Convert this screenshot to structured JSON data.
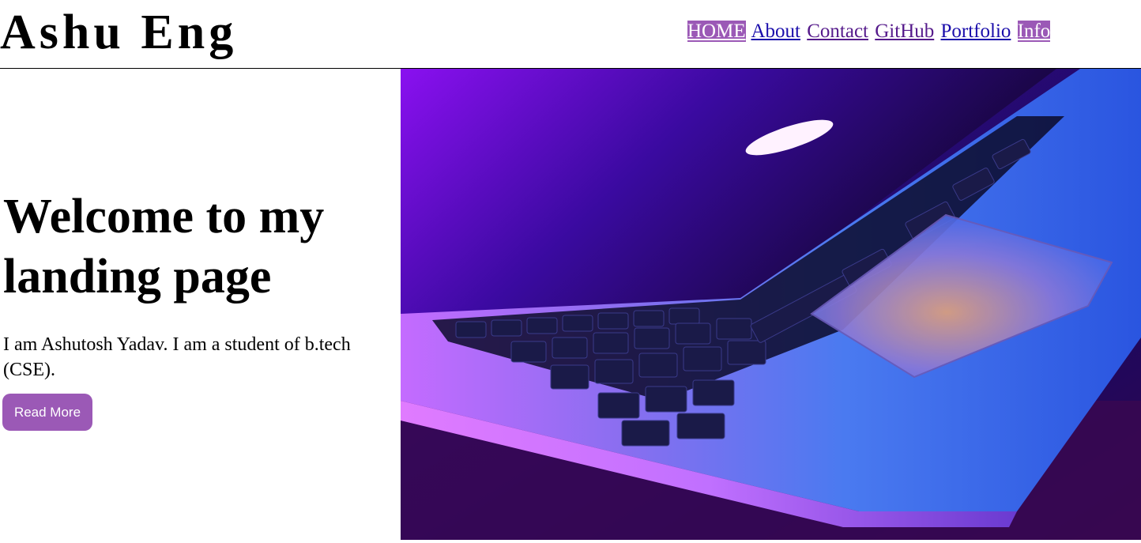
{
  "header": {
    "brand": "Ashu Eng",
    "nav": [
      {
        "label": "HOME",
        "state": "active"
      },
      {
        "label": "About",
        "state": "plain"
      },
      {
        "label": "Contact",
        "state": "visited"
      },
      {
        "label": "GitHub",
        "state": "visited"
      },
      {
        "label": "Portfolio",
        "state": "plain"
      },
      {
        "label": "Info",
        "state": "active"
      }
    ]
  },
  "hero": {
    "title": "Welcome to my landing page",
    "description": "I am Ashutosh Yadav. I am a student of b.tech (CSE).",
    "button_label": "Read More",
    "image": "laptop-photo"
  },
  "colors": {
    "accent": "#9b59b6",
    "link": "#1a0dab",
    "visited_link": "#551a8b"
  }
}
